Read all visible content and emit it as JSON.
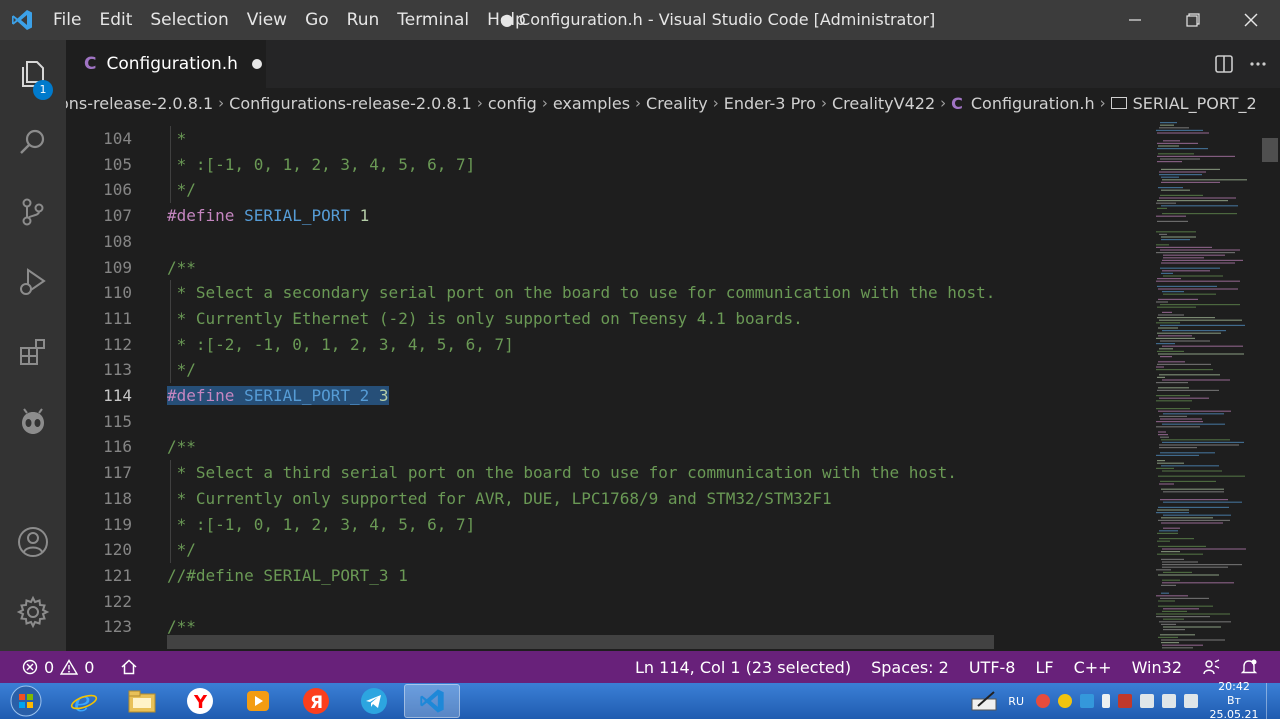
{
  "titlebar": {
    "menu": [
      "File",
      "Edit",
      "Selection",
      "View",
      "Go",
      "Run",
      "Terminal",
      "Help"
    ],
    "title": "● Configuration.h - Visual Studio Code [Administrator]"
  },
  "activitybar": {
    "explorer_badge": "1"
  },
  "tab": {
    "label": "Configuration.h",
    "icon_letter": "C"
  },
  "breadcrumb": {
    "items": [
      "ons-release-2.0.8.1",
      "Configurations-release-2.0.8.1",
      "config",
      "examples",
      "Creality",
      "Ender-3 Pro",
      "CrealityV422"
    ],
    "file": "Configuration.h",
    "symbol": "SERIAL_PORT_2"
  },
  "editor": {
    "lines": [
      {
        "n": "104",
        "parts": [
          {
            "t": " *",
            "c": "cmt"
          }
        ]
      },
      {
        "n": "105",
        "parts": [
          {
            "t": " * :[-1, 0, 1, 2, 3, 4, 5, 6, 7]",
            "c": "cmt"
          }
        ]
      },
      {
        "n": "106",
        "parts": [
          {
            "t": " */",
            "c": "cmt"
          }
        ]
      },
      {
        "n": "107",
        "parts": [
          {
            "t": "#define",
            "c": "kw"
          },
          {
            "t": " SERIAL_PORT",
            "c": "mac"
          },
          {
            "t": " 1",
            "c": "num"
          }
        ]
      },
      {
        "n": "108",
        "parts": []
      },
      {
        "n": "109",
        "parts": [
          {
            "t": "/**",
            "c": "cmt"
          }
        ]
      },
      {
        "n": "110",
        "parts": [
          {
            "t": " * Select a secondary serial port on the board to use for communication with the host.",
            "c": "cmt"
          }
        ]
      },
      {
        "n": "111",
        "parts": [
          {
            "t": " * Currently Ethernet (-2) is only supported on Teensy 4.1 boards.",
            "c": "cmt"
          }
        ]
      },
      {
        "n": "112",
        "parts": [
          {
            "t": " * :[-2, -1, 0, 1, 2, 3, 4, 5, 6, 7]",
            "c": "cmt"
          }
        ]
      },
      {
        "n": "113",
        "parts": [
          {
            "t": " */",
            "c": "cmt"
          }
        ]
      },
      {
        "n": "114",
        "active": true,
        "parts": [
          {
            "t": "#define",
            "c": "kw sel"
          },
          {
            "t": " SERIAL_PORT_2",
            "c": "mac sel"
          },
          {
            "t": " 3",
            "c": "num sel"
          }
        ]
      },
      {
        "n": "115",
        "parts": []
      },
      {
        "n": "116",
        "parts": [
          {
            "t": "/**",
            "c": "cmt"
          }
        ]
      },
      {
        "n": "117",
        "parts": [
          {
            "t": " * Select a third serial port on the board to use for communication with the host.",
            "c": "cmt"
          }
        ]
      },
      {
        "n": "118",
        "parts": [
          {
            "t": " * Currently only supported for AVR, DUE, LPC1768/9 and STM32/STM32F1",
            "c": "cmt"
          }
        ]
      },
      {
        "n": "119",
        "parts": [
          {
            "t": " * :[-1, 0, 1, 2, 3, 4, 5, 6, 7]",
            "c": "cmt"
          }
        ]
      },
      {
        "n": "120",
        "parts": [
          {
            "t": " */",
            "c": "cmt"
          }
        ]
      },
      {
        "n": "121",
        "parts": [
          {
            "t": "//#define SERIAL_PORT_3 1",
            "c": "cmt"
          }
        ]
      },
      {
        "n": "122",
        "parts": []
      },
      {
        "n": "123",
        "parts": [
          {
            "t": "/**",
            "c": "cmt"
          }
        ]
      }
    ]
  },
  "statusbar": {
    "errors": "0",
    "warnings": "0",
    "position": "Ln 114, Col 1 (23 selected)",
    "spaces": "Spaces: 2",
    "encoding": "UTF-8",
    "eol": "LF",
    "language": "C++",
    "platform": "Win32"
  },
  "taskbar": {
    "lang": "RU",
    "time": "20:42",
    "date": "Вт 25.05.21"
  },
  "colors": {
    "statusbar": "#68217a",
    "accent": "#007acc",
    "comment": "#6a9955",
    "keyword": "#c586c0",
    "macro": "#569cd6",
    "number": "#b5cea8"
  }
}
